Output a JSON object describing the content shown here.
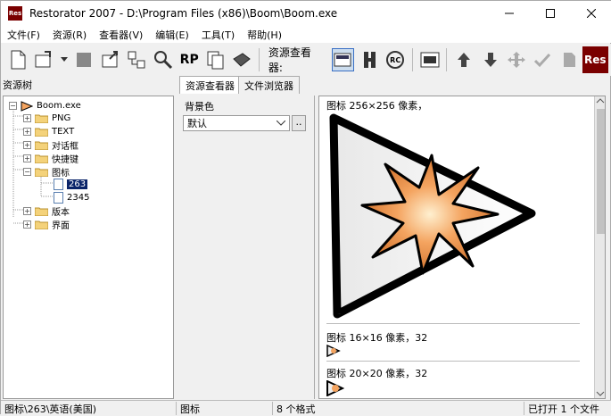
{
  "window": {
    "title": "Restorator 2007 - D:\\Program Files (x86)\\Boom\\Boom.exe",
    "app_icon_text": "Res",
    "controls": [
      "minimize",
      "maximize",
      "close"
    ]
  },
  "menu": [
    "文件(F)",
    "资源(R)",
    "查看器(V)",
    "编辑(E)",
    "工具(T)",
    "帮助(H)"
  ],
  "toolbar": {
    "viewer_label": "资源查看器:",
    "logo_text": "Res",
    "rp_label": "RP",
    "rc_label": "RC"
  },
  "left_pane": {
    "title": "资源树"
  },
  "tabs": [
    {
      "label": "资源查看器",
      "active": true
    },
    {
      "label": "文件浏览器",
      "active": false
    }
  ],
  "tree": [
    {
      "label": "Boom.exe",
      "type": "exe",
      "level": 0,
      "expanded": true
    },
    {
      "label": "PNG",
      "type": "folder",
      "level": 1
    },
    {
      "label": "TEXT",
      "type": "folder",
      "level": 1
    },
    {
      "label": "对话框",
      "type": "folder",
      "level": 1
    },
    {
      "label": "快捷键",
      "type": "folder",
      "level": 1
    },
    {
      "label": "图标",
      "type": "folder",
      "level": 1,
      "expanded": true
    },
    {
      "label": "263",
      "type": "doc",
      "level": 2,
      "selected": true
    },
    {
      "label": "2345",
      "type": "doc",
      "level": 2
    },
    {
      "label": "版本",
      "type": "folder",
      "level": 1
    },
    {
      "label": "界面",
      "type": "folder",
      "level": 1
    }
  ],
  "bg_panel": {
    "label": "背景色",
    "select_value": "默认",
    "dots_button": ".."
  },
  "viewer": {
    "icons": [
      {
        "caption": "图标 256×256 像素，",
        "size": 256
      },
      {
        "caption": "图标 16×16 像素，32",
        "size": 16
      },
      {
        "caption": "图标 20×20 像素，32",
        "size": 20
      }
    ]
  },
  "status": {
    "path": "图标\\263\\英语(美国)",
    "type": "图标",
    "formats": "8 个格式",
    "files": "已打开 1 个文件"
  },
  "colors": {
    "selection": "#0a246a",
    "logo": "#7a0000",
    "star": "#f4a460"
  }
}
